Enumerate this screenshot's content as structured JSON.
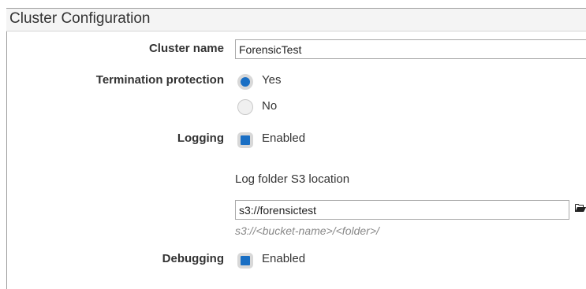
{
  "section": {
    "title": "Cluster Configuration"
  },
  "cluster_name": {
    "label": "Cluster name",
    "value": "ForensicTest"
  },
  "termination_protection": {
    "label": "Termination protection",
    "options": [
      {
        "label": "Yes",
        "selected": true
      },
      {
        "label": "No",
        "selected": false
      }
    ]
  },
  "logging": {
    "label": "Logging",
    "checkbox_label": "Enabled",
    "checked": true,
    "log_folder_label": "Log folder S3 location",
    "log_folder_value": "s3://forensictest",
    "log_folder_hint": "s3://<bucket-name>/<folder>/",
    "browse_icon": "folder-icon"
  },
  "debugging": {
    "label": "Debugging",
    "checkbox_label": "Enabled",
    "checked": true
  },
  "colors": {
    "accent": "#1a6fc4",
    "header_bg": "#f4f4f4"
  }
}
